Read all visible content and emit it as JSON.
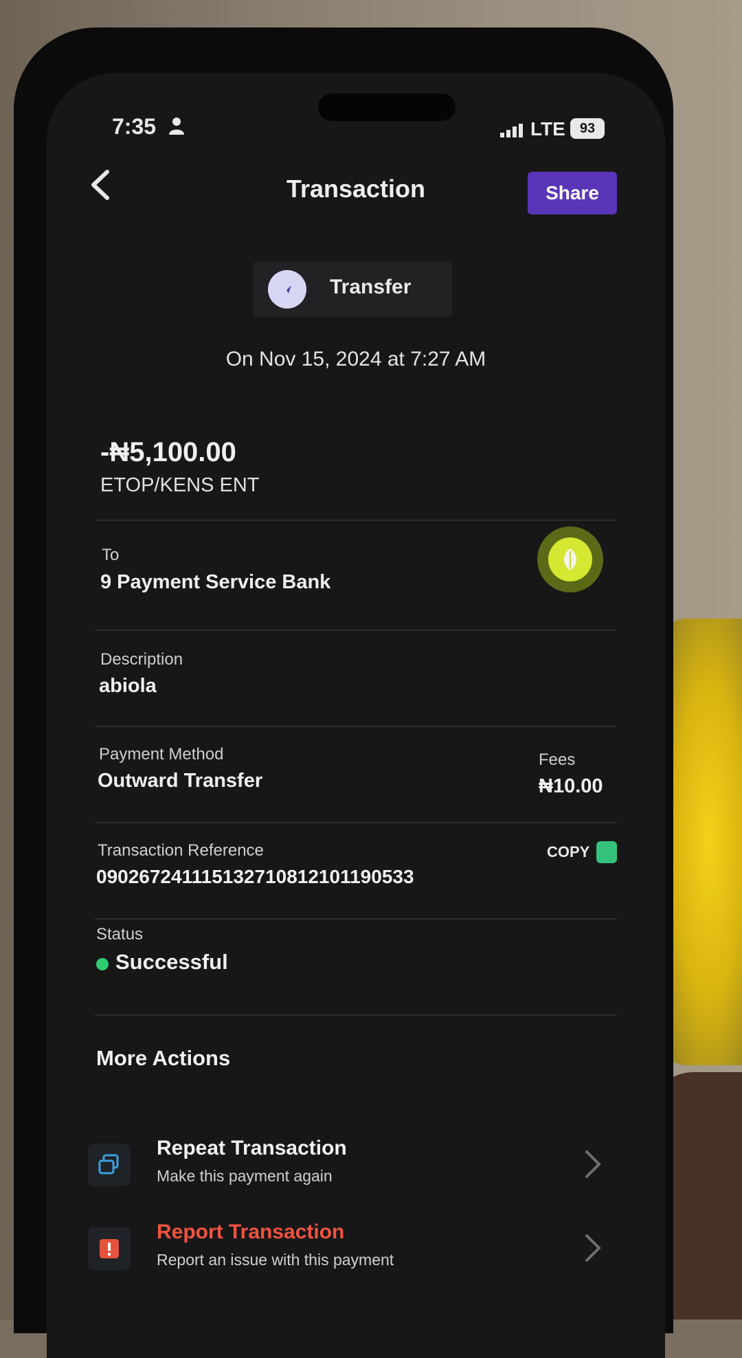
{
  "status_bar": {
    "time": "7:35",
    "network": "LTE",
    "battery": "93"
  },
  "header": {
    "title": "Transaction",
    "share_label": "Share"
  },
  "transaction": {
    "type_label": "Transfer",
    "date_text": "On Nov 15, 2024 at 7:27 AM",
    "amount": "-₦5,100.00",
    "counterparty": "ETOP/KENS ENT",
    "to_label": "To",
    "to_value": "9 Payment Service Bank",
    "description_label": "Description",
    "description_value": "abiola",
    "payment_method_label": "Payment Method",
    "payment_method_value": "Outward Transfer",
    "fees_label": "Fees",
    "fees_value": "₦10.00",
    "reference_label": "Transaction Reference",
    "reference_value": "090267241115132710812101190533",
    "copy_label": "COPY",
    "status_label": "Status",
    "status_value": "Successful"
  },
  "more_actions": {
    "title": "More Actions",
    "items": [
      {
        "title": "Repeat Transaction",
        "subtitle": "Make this payment again",
        "color": "#f2f2f2",
        "icon": "repeat-icon"
      },
      {
        "title": "Report Transaction",
        "subtitle": "Report an issue with this payment",
        "color": "#f0533e",
        "icon": "report-icon"
      }
    ]
  },
  "colors": {
    "accent": "#5a35b8",
    "success": "#2ecc6e",
    "danger": "#f0533e",
    "background": "#171718"
  }
}
